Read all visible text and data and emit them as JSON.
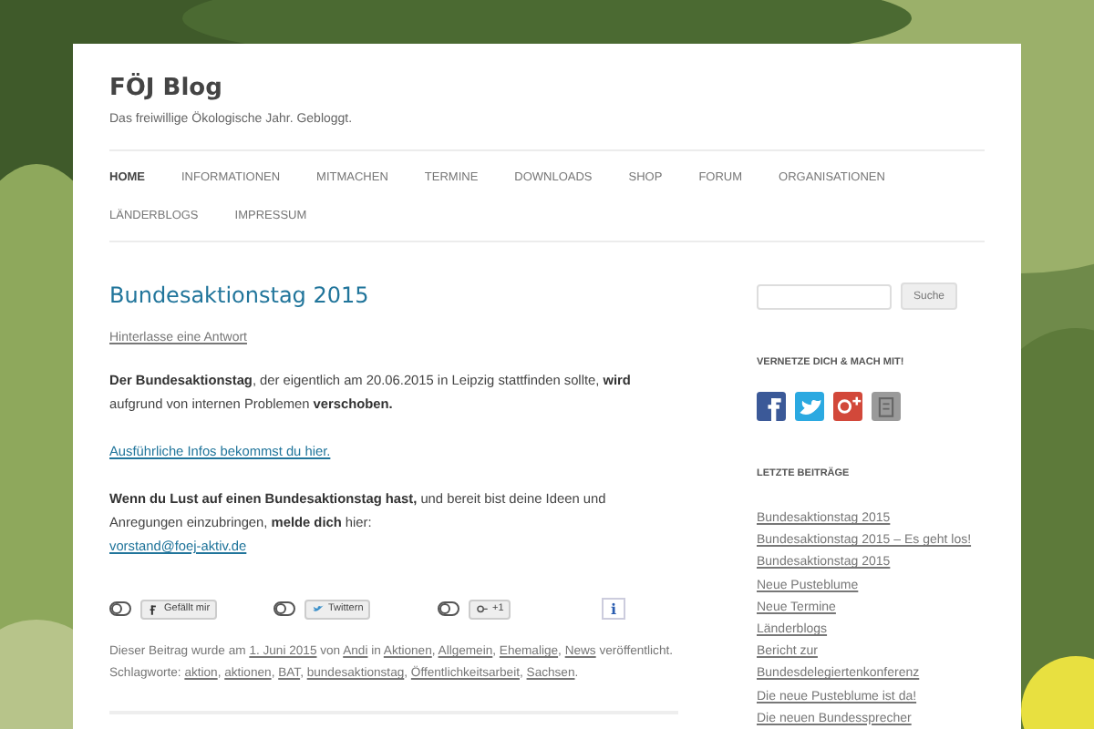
{
  "site": {
    "title": "FÖJ Blog",
    "tagline": "Das freiwillige Ökologische Jahr. Gebloggt."
  },
  "nav": [
    {
      "label": "HOME",
      "selected": true
    },
    {
      "label": "INFORMATIONEN",
      "selected": false
    },
    {
      "label": "MITMACHEN",
      "selected": false
    },
    {
      "label": "TERMINE",
      "selected": false
    },
    {
      "label": "DOWNLOADS",
      "selected": false
    },
    {
      "label": "SHOP",
      "selected": false
    },
    {
      "label": "FORUM",
      "selected": false
    },
    {
      "label": "ORGANISATIONEN",
      "selected": false
    },
    {
      "label": "LÄNDERBLOGS",
      "selected": false
    },
    {
      "label": "IMPRESSUM",
      "selected": false
    }
  ],
  "post": {
    "title": "Bundesaktionstag 2015",
    "reply_link": "Hinterlasse eine Antwort",
    "paragraphs": [
      [
        {
          "kind": "bold",
          "text": "Der Bundesaktionstag"
        },
        {
          "kind": "text",
          "text": ", der eigentlich am 20.06.2015 in Leipzig stattfinden sollte, "
        },
        {
          "kind": "bold",
          "text": "wird"
        },
        {
          "kind": "text",
          "text": " aufgrund von internen Problemen "
        },
        {
          "kind": "bold",
          "text": "verschoben."
        }
      ],
      [
        {
          "kind": "link",
          "text": "Ausführliche Infos bekommst du hier."
        }
      ],
      [
        {
          "kind": "bold",
          "text": "Wenn du Lust auf einen Bundesaktionstag hast,"
        },
        {
          "kind": "text",
          "text": " und bereit bist deine Ideen und Anregungen einzubringen, "
        },
        {
          "kind": "bold",
          "text": "melde dich"
        },
        {
          "kind": "text",
          "text": " hier: "
        },
        {
          "kind": "break"
        },
        {
          "kind": "link",
          "text": "vorstand@foej-aktiv.de"
        }
      ]
    ],
    "share": [
      {
        "kind": "facebook",
        "label": "Gefällt mir",
        "on": false
      },
      {
        "kind": "twitter",
        "label": "Twittern",
        "on": false
      },
      {
        "kind": "gplus",
        "label": "+1",
        "on": false
      }
    ],
    "info_button": "i",
    "meta": [
      {
        "kind": "text",
        "text": "Dieser Beitrag wurde am "
      },
      {
        "kind": "link",
        "text": "1. Juni 2015"
      },
      {
        "kind": "text",
        "text": " von "
      },
      {
        "kind": "link",
        "text": "Andi"
      },
      {
        "kind": "text",
        "text": " in "
      },
      {
        "kind": "link",
        "text": "Aktionen"
      },
      {
        "kind": "text",
        "text": ", "
      },
      {
        "kind": "link",
        "text": "Allgemein"
      },
      {
        "kind": "text",
        "text": ", "
      },
      {
        "kind": "link",
        "text": "Ehemalige"
      },
      {
        "kind": "text",
        "text": ", "
      },
      {
        "kind": "link",
        "text": "News"
      },
      {
        "kind": "text",
        "text": " veröffentlicht. Schlagworte: "
      },
      {
        "kind": "link",
        "text": "aktion"
      },
      {
        "kind": "text",
        "text": ", "
      },
      {
        "kind": "link",
        "text": "aktionen"
      },
      {
        "kind": "text",
        "text": ", "
      },
      {
        "kind": "link",
        "text": "BAT"
      },
      {
        "kind": "text",
        "text": ", "
      },
      {
        "kind": "link",
        "text": "bundesaktionstag"
      },
      {
        "kind": "text",
        "text": ", "
      },
      {
        "kind": "link",
        "text": "Öffentlichkeitsarbeit"
      },
      {
        "kind": "text",
        "text": ", "
      },
      {
        "kind": "link",
        "text": "Sachsen"
      },
      {
        "kind": "text",
        "text": "."
      }
    ]
  },
  "sidebar": {
    "search_button": "Suche",
    "social_heading": "VERNETZE DICH & MACH MIT!",
    "social": [
      {
        "kind": "facebook",
        "color": "#3b5998"
      },
      {
        "kind": "twitter",
        "color": "#2ba9e1"
      },
      {
        "kind": "gplus",
        "color": "#d2483a"
      },
      {
        "kind": "other",
        "color": "#9a9a9a"
      }
    ],
    "recent_heading": "LETZTE BEITRÄGE",
    "recent": [
      "Bundesaktionstag 2015",
      "Bundesaktionstag 2015 – Es geht los!",
      "Bundesaktionstag 2015",
      "Neue Pusteblume",
      "Neue Termine",
      "Länderblogs",
      "Bericht zur",
      "Bundesdelegiertenkonferenz",
      "Die neue Pusteblume ist da!",
      "Die neuen Bundessprecher"
    ]
  }
}
